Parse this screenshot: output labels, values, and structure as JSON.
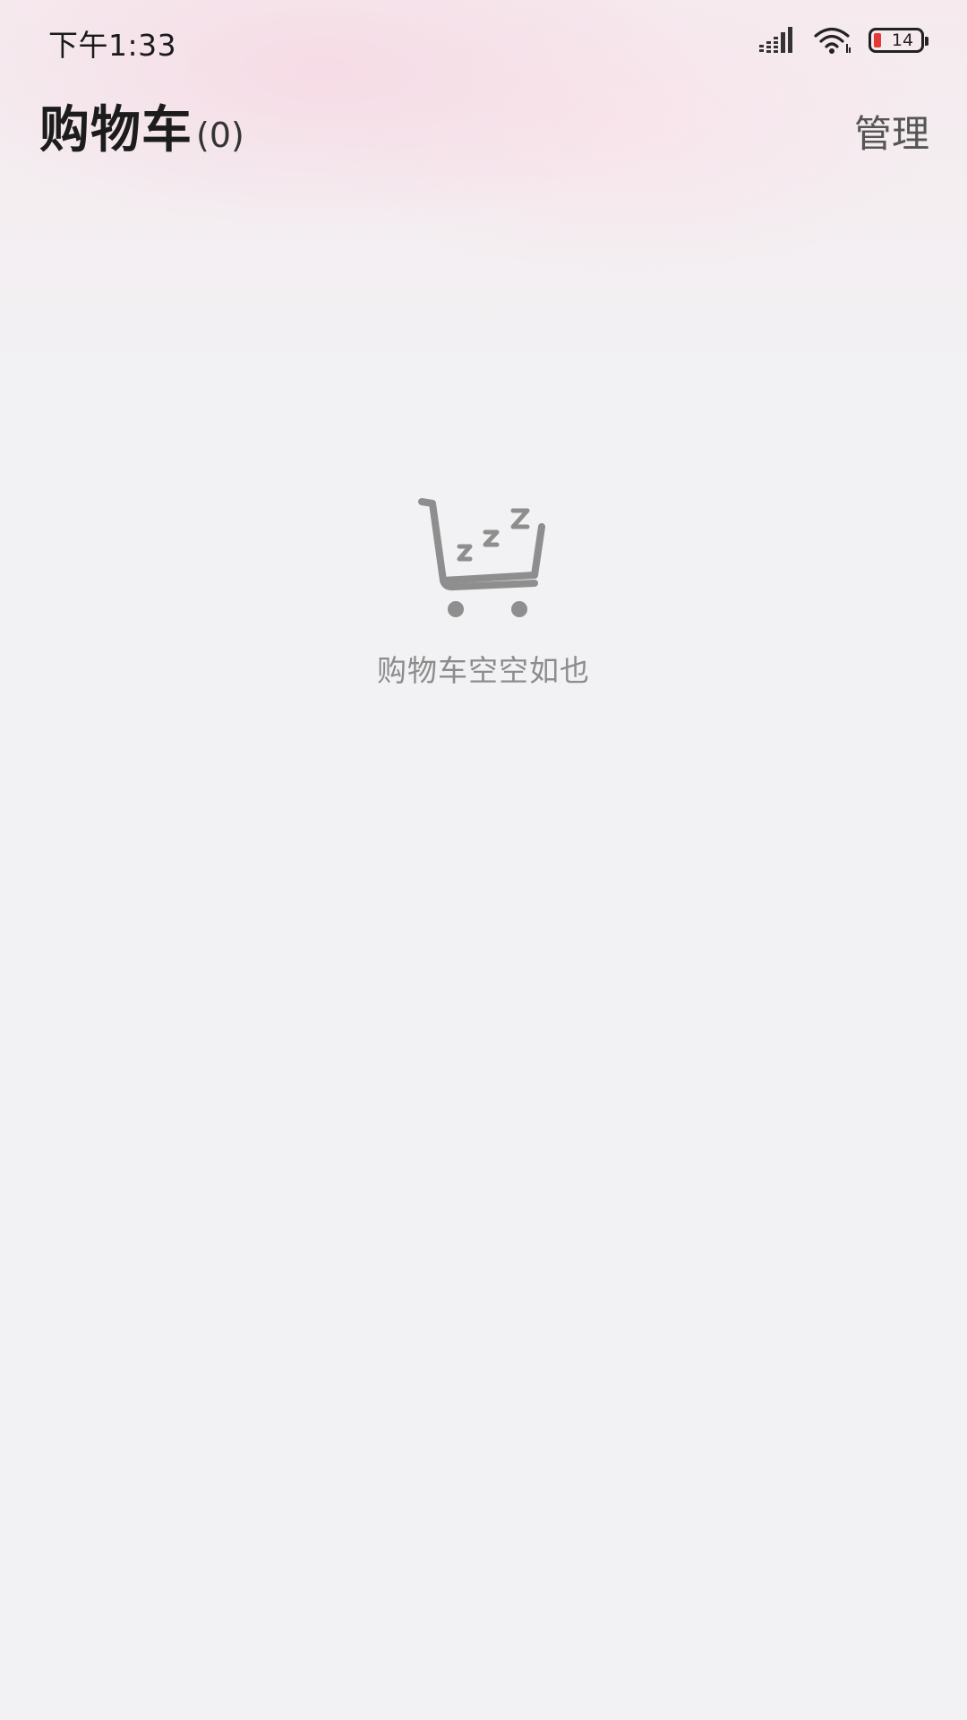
{
  "status_bar": {
    "time": "下午1:33",
    "battery_level": "14",
    "icons": [
      "signal-icon",
      "wifi-icon",
      "battery-icon"
    ],
    "battery_color": "#e53935"
  },
  "header": {
    "title": "购物车",
    "count": "(0)",
    "manage_label": "管理"
  },
  "empty_state": {
    "icon": "sleeping-cart-icon",
    "message": "购物车空空如也"
  },
  "colors": {
    "background": "#f2f1f3",
    "header_tint": "#f6d6e2",
    "muted_text": "#8c8c8c"
  }
}
